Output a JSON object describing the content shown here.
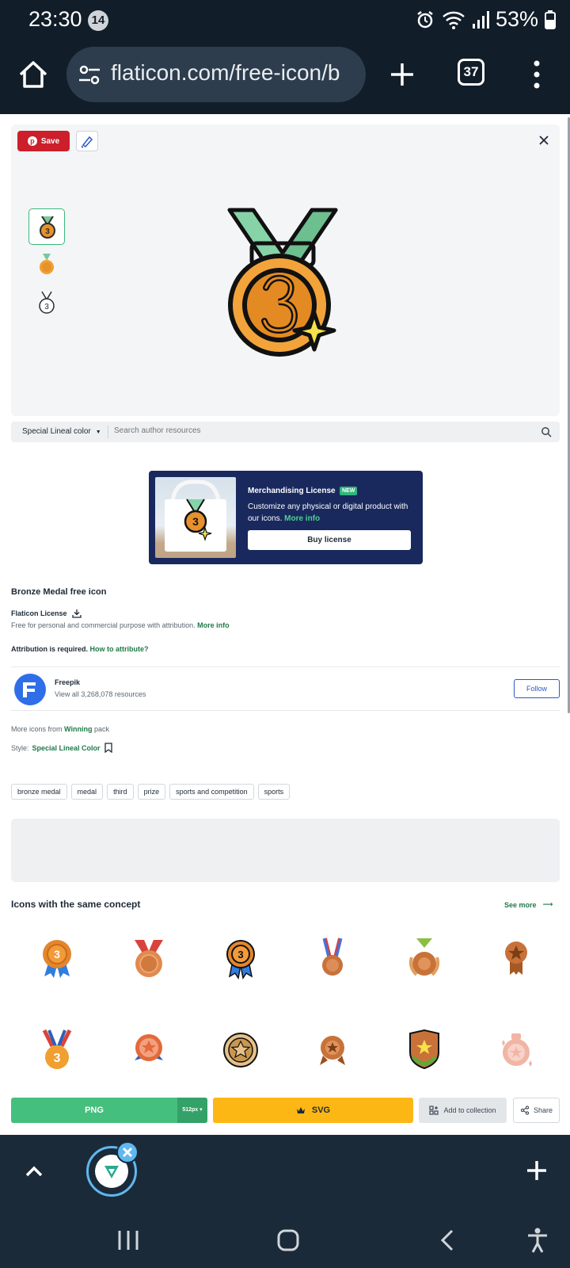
{
  "status_bar": {
    "time": "23:30",
    "notification_count": "14",
    "battery": "53%"
  },
  "browser": {
    "url": "flaticon.com/free-icon/b",
    "tab_count": "37"
  },
  "preview": {
    "save_label": "Save"
  },
  "search": {
    "style_select": "Special Lineal color",
    "placeholder": "Search author resources"
  },
  "promo": {
    "title": "Merchandising License",
    "badge": "NEW",
    "description": "Customize any physical or digital product with our icons.",
    "more_info": "More info",
    "button": "Buy license"
  },
  "info": {
    "title": "Bronze Medal free icon",
    "license_label": "Flaticon License",
    "license_desc": "Free for personal and commercial purpose with attribution.",
    "license_more": "More info",
    "attribution": "Attribution is required.",
    "how_to": "How to attribute?"
  },
  "author": {
    "name": "Freepik",
    "resources": "View all 3,268,078 resources",
    "follow": "Follow"
  },
  "pack": {
    "prefix": "More icons from",
    "name": "Winning",
    "suffix": "pack"
  },
  "style": {
    "label": "Style:",
    "name": "Special Lineal Color"
  },
  "tags": [
    "bronze medal",
    "medal",
    "third",
    "prize",
    "sports and competition",
    "sports"
  ],
  "concept": {
    "title": "Icons with the same concept",
    "see_more": "See more"
  },
  "actions": {
    "png": "PNG",
    "png_size": "512px",
    "svg": "SVG",
    "collection": "Add to collection",
    "share": "Share"
  },
  "colors": {
    "green": "#45bf7d",
    "yellow": "#fdb714",
    "navy": "#19295e",
    "dark": "#111d29"
  }
}
